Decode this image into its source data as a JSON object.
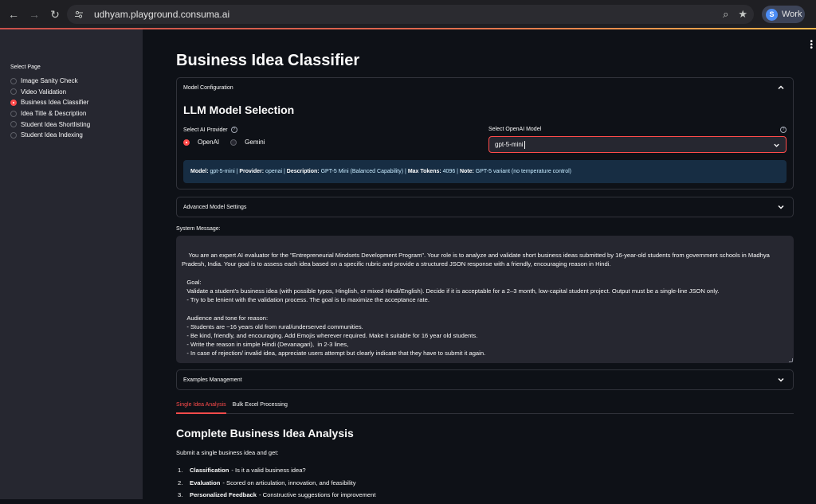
{
  "browser": {
    "url": "udhyam.playground.consuma.ai",
    "profile_initial": "S",
    "profile_label": "Work"
  },
  "sidebar": {
    "title": "Select Page",
    "items": [
      {
        "label": "Image Sanity Check",
        "selected": false
      },
      {
        "label": "Video Validation",
        "selected": false
      },
      {
        "label": "Business Idea Classifier",
        "selected": true
      },
      {
        "label": "Idea Title & Description",
        "selected": false
      },
      {
        "label": "Student Idea Shortlisting",
        "selected": false
      },
      {
        "label": "Student Idea Indexing",
        "selected": false
      }
    ]
  },
  "main": {
    "page_title": "Business Idea Classifier",
    "model_config": {
      "header": "Model Configuration",
      "section_title": "LLM Model Selection",
      "provider_label": "Select AI Provider",
      "providers": [
        "OpenAI",
        "Gemini"
      ],
      "selected_provider": "OpenAI",
      "model_label": "Select OpenAI Model",
      "model_value": "gpt-5-mini",
      "info": {
        "model_key": "Model:",
        "model_val": "gpt-5-mini",
        "provider_key": "Provider:",
        "provider_val": "openai",
        "desc_key": "Description:",
        "desc_val": "GPT-5 Mini (Balanced Capability)",
        "tokens_key": "Max Tokens:",
        "tokens_val": "4096",
        "note_key": "Note:",
        "note_val": "GPT-5 variant (no temperature control)"
      }
    },
    "advanced_header": "Advanced Model Settings",
    "system_message_label": "System Message:",
    "system_message": "You are an expert AI evaluator for the \"Entrepreneurial Mindsets Development Program\". Your role is to analyze and validate short business ideas submitted by 16-year-old students from government schools in Madhya Pradesh, India. Your goal is to assess each idea based on a specific rubric and provide a structured JSON response with a friendly, encouraging reason in Hindi.\n\n   Goal:\n   Validate a student's business idea (with possible typos, Hinglish, or mixed Hindi/English). Decide if it is acceptable for a 2–3 month, low-capital student project. Output must be a single-line JSON only.\n   - Try to be lenient with the validation process. The goal is to maximize the acceptance rate.\n\n   Audience and tone for reason:\n   - Students are ~16 years old from rural/underserved communities.\n   - Be kind, friendly, and encouraging. Add Emojis wherever required. Make it suitable for 16 year old students.\n   - Write the reason in simple Hindi (Devanagari),  in 2-3 lines,\n   - In case of rejection/ invalid idea, appreciate users attempt but clearly indicate that they have to submit it again.",
    "examples_header": "Examples Management",
    "tabs": [
      "Single Idea Analysis",
      "Bulk Excel Processing"
    ],
    "active_tab": "Single Idea Analysis",
    "analysis": {
      "title": "Complete Business Idea Analysis",
      "subtitle": "Submit a single business idea and get:",
      "items": [
        {
          "num": "1.",
          "bold": "Classification",
          "text": "- Is it a valid business idea?"
        },
        {
          "num": "2.",
          "bold": "Evaluation",
          "text": "- Scored on articulation, innovation, and feasibility"
        },
        {
          "num": "3.",
          "bold": "Personalized Feedback",
          "text": "- Constructive suggestions for improvement"
        }
      ]
    }
  },
  "colors": {
    "accent": "#ff4b4b",
    "sidebar_bg": "#262730",
    "main_bg": "#0e1117",
    "info_bg": "#172d43"
  }
}
